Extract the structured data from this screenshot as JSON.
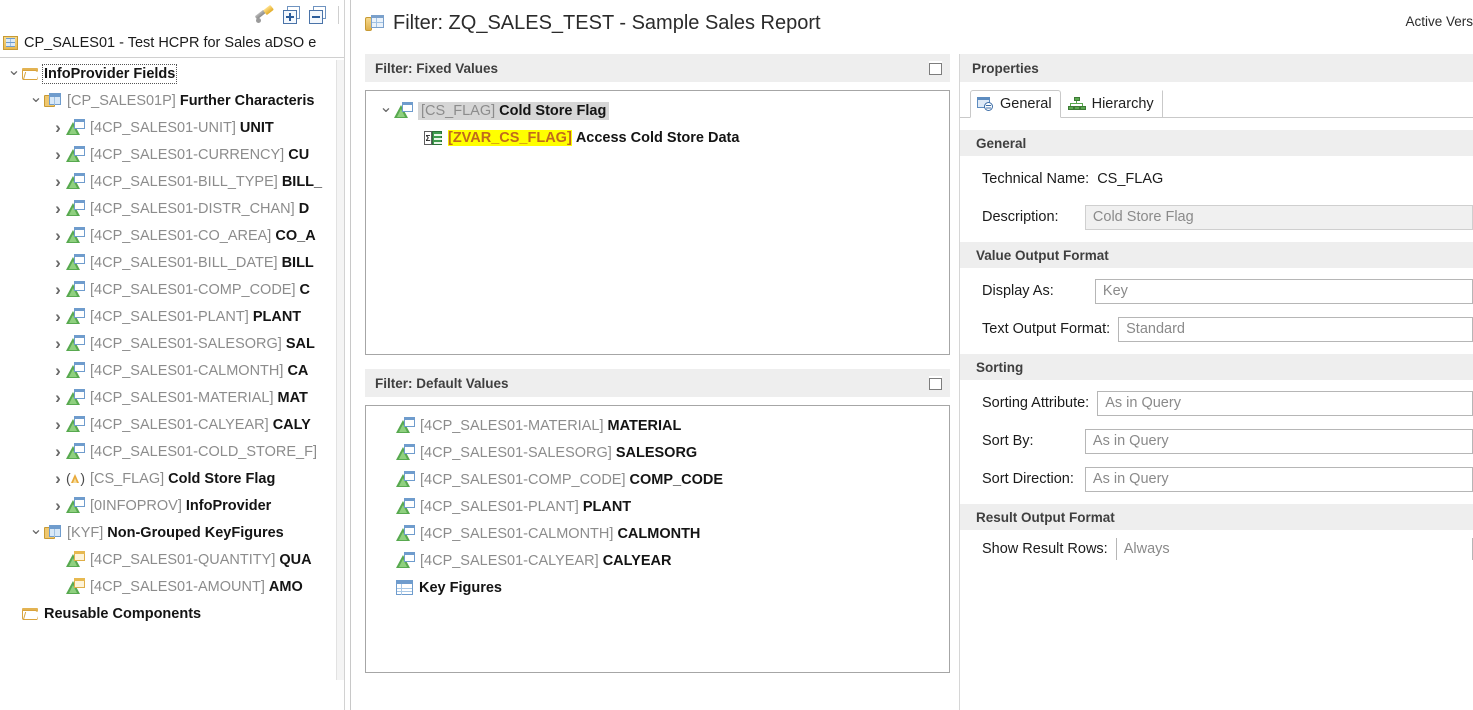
{
  "left_panel": {
    "toolbar": {
      "wand_tooltip": "Edit",
      "expand_all_tooltip": "Expand All",
      "collapse_all_tooltip": "Collapse All"
    },
    "root": {
      "label": "CP_SALES01 - Test HCPR for Sales aDSO e",
      "icon": "hcpr-icon"
    },
    "tree": [
      {
        "indent": 0,
        "twist": "down",
        "icon": "folder-icon",
        "tech": "",
        "name": "InfoProvider Fields",
        "selected": true
      },
      {
        "indent": 1,
        "twist": "down",
        "icon": "dimension-folder-icon",
        "tech": "[CP_SALES01P]",
        "name": "Further Characteris",
        "selected": false
      },
      {
        "indent": 2,
        "twist": "right",
        "icon": "characteristic-icon",
        "tech": "[4CP_SALES01-UNIT]",
        "name": "UNIT",
        "selected": false
      },
      {
        "indent": 2,
        "twist": "right",
        "icon": "characteristic-icon",
        "tech": "[4CP_SALES01-CURRENCY]",
        "name": "CU",
        "selected": false
      },
      {
        "indent": 2,
        "twist": "right",
        "icon": "characteristic-icon",
        "tech": "[4CP_SALES01-BILL_TYPE]",
        "name": "BILL_",
        "selected": false
      },
      {
        "indent": 2,
        "twist": "right",
        "icon": "characteristic-icon",
        "tech": "[4CP_SALES01-DISTR_CHAN]",
        "name": "D",
        "selected": false
      },
      {
        "indent": 2,
        "twist": "right",
        "icon": "characteristic-icon",
        "tech": "[4CP_SALES01-CO_AREA]",
        "name": "CO_A",
        "selected": false
      },
      {
        "indent": 2,
        "twist": "right",
        "icon": "characteristic-icon",
        "tech": "[4CP_SALES01-BILL_DATE]",
        "name": "BILL",
        "selected": false
      },
      {
        "indent": 2,
        "twist": "right",
        "icon": "characteristic-icon",
        "tech": "[4CP_SALES01-COMP_CODE]",
        "name": "C",
        "selected": false
      },
      {
        "indent": 2,
        "twist": "right",
        "icon": "characteristic-icon",
        "tech": "[4CP_SALES01-PLANT]",
        "name": "PLANT",
        "selected": false
      },
      {
        "indent": 2,
        "twist": "right",
        "icon": "characteristic-icon",
        "tech": "[4CP_SALES01-SALESORG]",
        "name": "SAL",
        "selected": false
      },
      {
        "indent": 2,
        "twist": "right",
        "icon": "characteristic-icon",
        "tech": "[4CP_SALES01-CALMONTH]",
        "name": "CA",
        "selected": false
      },
      {
        "indent": 2,
        "twist": "right",
        "icon": "characteristic-icon",
        "tech": "[4CP_SALES01-MATERIAL]",
        "name": "MAT",
        "selected": false
      },
      {
        "indent": 2,
        "twist": "right",
        "icon": "characteristic-icon",
        "tech": "[4CP_SALES01-CALYEAR]",
        "name": "CALY",
        "selected": false
      },
      {
        "indent": 2,
        "twist": "right",
        "icon": "characteristic-icon",
        "tech": "[4CP_SALES01-COLD_STORE_F]",
        "name": "",
        "selected": false
      },
      {
        "indent": 2,
        "twist": "right",
        "icon": "calculated-characteristic-icon",
        "tech": "[CS_FLAG]",
        "name": "Cold Store Flag",
        "selected": false
      },
      {
        "indent": 2,
        "twist": "right",
        "icon": "characteristic-icon",
        "tech": "[0INFOPROV]",
        "name": "InfoProvider",
        "selected": false
      },
      {
        "indent": 1,
        "twist": "down",
        "icon": "dimension-folder-icon",
        "tech": "[KYF]",
        "name": "Non-Grouped KeyFigures",
        "selected": false
      },
      {
        "indent": 2,
        "twist": "none",
        "icon": "keyfigure-icon",
        "tech": "[4CP_SALES01-QUANTITY]",
        "name": "QUA",
        "selected": false
      },
      {
        "indent": 2,
        "twist": "none",
        "icon": "keyfigure-icon",
        "tech": "[4CP_SALES01-AMOUNT]",
        "name": "AMO",
        "selected": false
      },
      {
        "indent": 0,
        "twist": "none",
        "icon": "folder-icon",
        "tech": "",
        "name": "Reusable Components",
        "selected": false
      }
    ]
  },
  "dialog": {
    "title": "Filter: ZQ_SALES_TEST - Sample Sales Report",
    "title_icon": "filter-table-icon",
    "active_version": "Active Vers",
    "fixed_values": {
      "header": "Filter: Fixed Values",
      "maximize_icon": "maximize-icon",
      "items": [
        {
          "indent": 1,
          "twist": "down",
          "icon": "characteristic-icon",
          "tech": "[CS_FLAG]",
          "name": "Cold Store Flag",
          "selected": true,
          "highlighted": false
        },
        {
          "indent": 2,
          "twist": "none",
          "icon": "variable-icon",
          "tech": "[ZVAR_CS_FLAG]",
          "name": "Access Cold Store Data",
          "selected": false,
          "highlighted": true
        }
      ]
    },
    "default_values": {
      "header": "Filter: Default Values",
      "maximize_icon": "maximize-icon",
      "items": [
        {
          "icon": "characteristic-icon",
          "tech": "[4CP_SALES01-MATERIAL]",
          "name": "MATERIAL"
        },
        {
          "icon": "characteristic-icon",
          "tech": "[4CP_SALES01-SALESORG]",
          "name": "SALESORG"
        },
        {
          "icon": "characteristic-icon",
          "tech": "[4CP_SALES01-COMP_CODE]",
          "name": "COMP_CODE"
        },
        {
          "icon": "characteristic-icon",
          "tech": "[4CP_SALES01-PLANT]",
          "name": "PLANT"
        },
        {
          "icon": "characteristic-icon",
          "tech": "[4CP_SALES01-CALMONTH]",
          "name": "CALMONTH"
        },
        {
          "icon": "characteristic-icon",
          "tech": "[4CP_SALES01-CALYEAR]",
          "name": "CALYEAR"
        },
        {
          "icon": "keyfigures-table-icon",
          "tech": "",
          "name": "Key Figures"
        }
      ]
    },
    "properties": {
      "header": "Properties",
      "tabs": [
        {
          "label": "General",
          "icon": "general-tab-icon",
          "active": true
        },
        {
          "label": "Hierarchy",
          "icon": "hierarchy-tab-icon",
          "active": false
        }
      ],
      "general_group": {
        "header": "General",
        "technical_name_label": "Technical Name:",
        "technical_name_value": "CS_FLAG",
        "description_label": "Description:",
        "description_value": "Cold Store Flag"
      },
      "value_output_format_group": {
        "header": "Value Output Format",
        "display_as_label": "Display As:",
        "display_as_value": "Key",
        "text_output_format_label": "Text Output Format:",
        "text_output_format_value": "Standard"
      },
      "sorting_group": {
        "header": "Sorting",
        "sorting_attribute_label": "Sorting Attribute:",
        "sorting_attribute_value": "As in Query",
        "sort_by_label": "Sort By:",
        "sort_by_value": "As in Query",
        "sort_direction_label": "Sort Direction:",
        "sort_direction_value": "As in Query"
      },
      "result_output_format_group": {
        "header": "Result Output Format",
        "show_result_rows_label": "Show Result Rows:",
        "show_result_rows_value": "Always"
      }
    }
  }
}
